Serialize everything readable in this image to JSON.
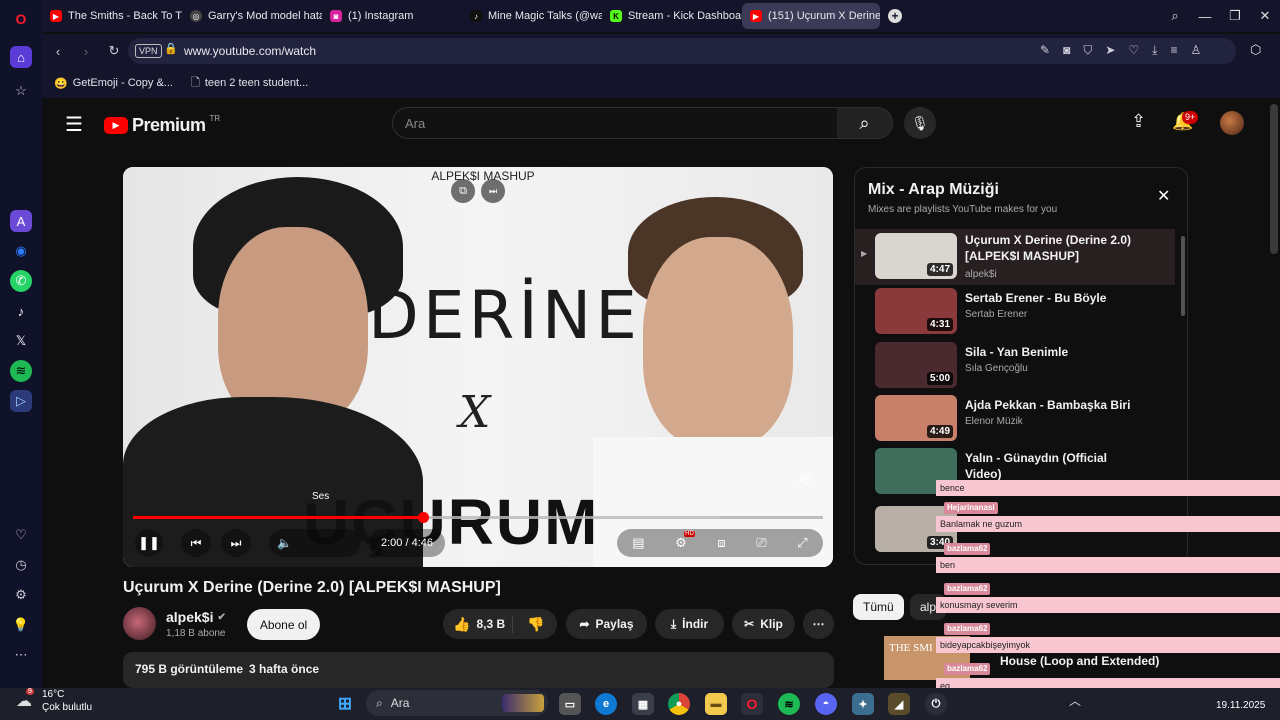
{
  "browser": {
    "tabs": [
      {
        "label": "The Smiths - Back To The",
        "color": "#ff0000",
        "active": false
      },
      {
        "label": "Garry's Mod model hatası",
        "color": "#444444",
        "active": false
      },
      {
        "label": "(1) Instagram",
        "color": "#d6249f",
        "active": false
      },
      {
        "label": "Mine Magic Talks (@wand",
        "color": "#111111",
        "active": false
      },
      {
        "label": "Stream - Kick Dashboard",
        "color": "#53fc18",
        "active": false
      },
      {
        "label": "(151) Uçurum X Derine",
        "color": "#ff0000",
        "active": true
      }
    ],
    "new_tab": "+",
    "vpn_label": "VPN",
    "url": "www.youtube.com/watch",
    "bookmarks": [
      {
        "label": "GetEmoji - Copy &...",
        "icon": "emoji-icon"
      },
      {
        "label": "teen 2 teen student...",
        "icon": "document-icon"
      }
    ]
  },
  "youtube": {
    "logo_text": "Premium",
    "region": "TR",
    "search_placeholder": "Ara",
    "notification_count": "9+",
    "video": {
      "title": "Uçurum X Derine (Derine 2.0) [ALPEK$I MASHUP]",
      "overlay_top": "ALPEK$I MASHUP",
      "poster_word1": "DERİNE",
      "poster_x": "X",
      "poster_word2": "UÇURUM",
      "time": "2:00 / 4:46",
      "volume_tooltip": "Ses",
      "progress": 0.42,
      "buffered": 0.85,
      "hd_badge": "HD"
    },
    "channel": {
      "name": "alpek$i",
      "subs": "1,18 B abone",
      "subscribe": "Abone ol"
    },
    "actions": {
      "likes": "8,3 B",
      "share": "Paylaş",
      "download": "İndir",
      "clip": "Klip",
      "more": "⋯"
    },
    "description": {
      "views": "795 B görüntüleme",
      "age": "3 hafta önce"
    },
    "playlist": {
      "title": "Mix - Arap Müziği",
      "subtitle": "Mixes are playlists YouTube makes for you",
      "items": [
        {
          "title": "Uçurum X Derine (Derine 2.0) [ALPEK$I MASHUP]",
          "channel": "alpek$i",
          "duration": "4:47",
          "bg": "#d9d6cf",
          "playing": true
        },
        {
          "title": "Sertab Erener - Bu Böyle",
          "channel": "Sertab Erener",
          "duration": "4:31",
          "bg": "#8a3a3a",
          "playing": false
        },
        {
          "title": "Sila - Yan Benimle",
          "channel": "Sıla Gençoğlu",
          "duration": "5:00",
          "bg": "#4a2a2f",
          "playing": false
        },
        {
          "title": "Ajda Pekkan - Bambaşka Biri",
          "channel": "Elenor Müzik",
          "duration": "4:49",
          "bg": "#c9806a",
          "playing": false
        },
        {
          "title": "Yalın - Günaydın (Official Video)",
          "channel": "",
          "duration": "",
          "bg": "#3f6e5c",
          "playing": false
        },
        {
          "title": "",
          "channel": "",
          "duration": "3:40",
          "bg": "#b8b0a6",
          "playing": false
        }
      ]
    },
    "chips": [
      "Tümü",
      "alp"
    ],
    "bottom_video": {
      "title": "House (Loop and Extended)",
      "thumb_text": "THE SMI"
    }
  },
  "chat_overlay": [
    {
      "user": "",
      "text": "bence"
    },
    {
      "user": "Hejarinanasi",
      "text": "Banlamak ne guzum"
    },
    {
      "user": "bazlama62",
      "text": "ben"
    },
    {
      "user": "bazlama62",
      "text": "konusmayı severim"
    },
    {
      "user": "bazlama62",
      "text": "bideyapcakbişeyimyok"
    },
    {
      "user": "bazlama62",
      "text": "eq"
    },
    {
      "user": "bazlama62",
      "text": ""
    }
  ],
  "taskbar": {
    "weather_temp": "16°C",
    "weather_desc": "Çok bulutlu",
    "weather_badge": "9",
    "search_label": "Ara",
    "date": "19.11.2025"
  }
}
